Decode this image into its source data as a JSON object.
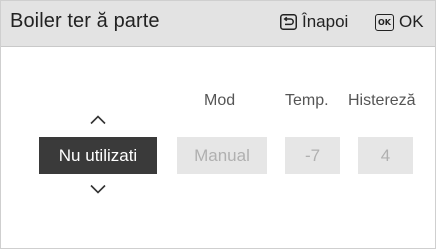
{
  "header": {
    "title": "Boiler ter ă parte",
    "back_label": "Înapoi",
    "ok_badge": "OK",
    "ok_label": "OK"
  },
  "columns": {
    "mode_label": "Mod",
    "temp_label": "Temp.",
    "hysteresis_label": "Histereză"
  },
  "values": {
    "usage": "Nu utilizati",
    "mode": "Manual",
    "temp": "-7",
    "hysteresis": "4"
  },
  "colors": {
    "header_bg": "#e3e3e3",
    "selected_bg": "#3a3a3a",
    "disabled_bg": "#e6e6e6",
    "disabled_text": "#b0b0b0"
  }
}
